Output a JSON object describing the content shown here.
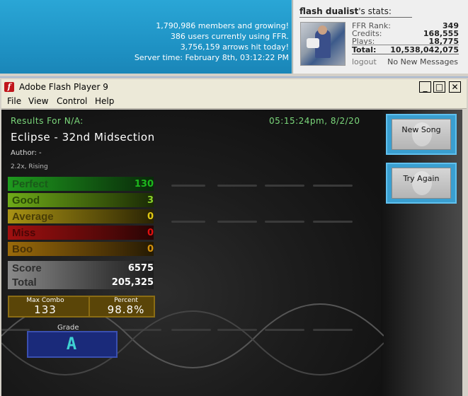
{
  "site": {
    "members_line": "1,790,986 members and growing!",
    "users_line": "386 users currently using FFR.",
    "arrows_line": "3,756,159 arrows hit today!",
    "server_time_line": "Server time: February 8th, 03:12:22 PM"
  },
  "user_stats": {
    "username": "flash dualist",
    "title_suffix": "'s stats:",
    "rank_label": "FFR Rank:",
    "rank_value": "349",
    "credits_label": "Credits:",
    "credits_value": "168,555",
    "plays_label": "Plays:",
    "plays_value": "18,775",
    "total_label": "Total:",
    "total_value": "10,538,042,075",
    "logout": "logout",
    "messages": "No New Messages"
  },
  "window": {
    "title": "Adobe Flash Player 9",
    "icon": "flash-player-icon",
    "controls": {
      "minimize": "_",
      "maximize": "□",
      "close": "✕"
    }
  },
  "menu": {
    "file": "File",
    "view": "View",
    "control": "Control",
    "help": "Help"
  },
  "game": {
    "results_for": "Results For N/A:",
    "timestamp": "05:15:24pm, 8/2/20",
    "song_title": "Eclipse - 32nd Midsection",
    "author": "Author: -",
    "difficulty": "2.2x, Rising",
    "judgements": {
      "perfect_label": "Perfect",
      "perfect_value": "130",
      "perfect_color": "#1db81d",
      "good_label": "Good",
      "good_value": "3",
      "good_color": "#8bd12a",
      "average_label": "Average",
      "average_value": "0",
      "average_color": "#e0c814",
      "miss_label": "Miss",
      "miss_value": "0",
      "miss_color": "#e01010",
      "boo_label": "Boo",
      "boo_value": "0",
      "boo_color": "#d4920e"
    },
    "score_label": "Score",
    "score_value": "6575",
    "total_label": "Total",
    "total_value": "205,325",
    "max_combo_label": "Max Combo",
    "max_combo_value": "133",
    "percent_label": "Percent",
    "percent_value": "98.8%",
    "grade_label": "Grade",
    "grade_value": "A",
    "new_song_button": "New Song",
    "try_again_button": "Try Again"
  }
}
